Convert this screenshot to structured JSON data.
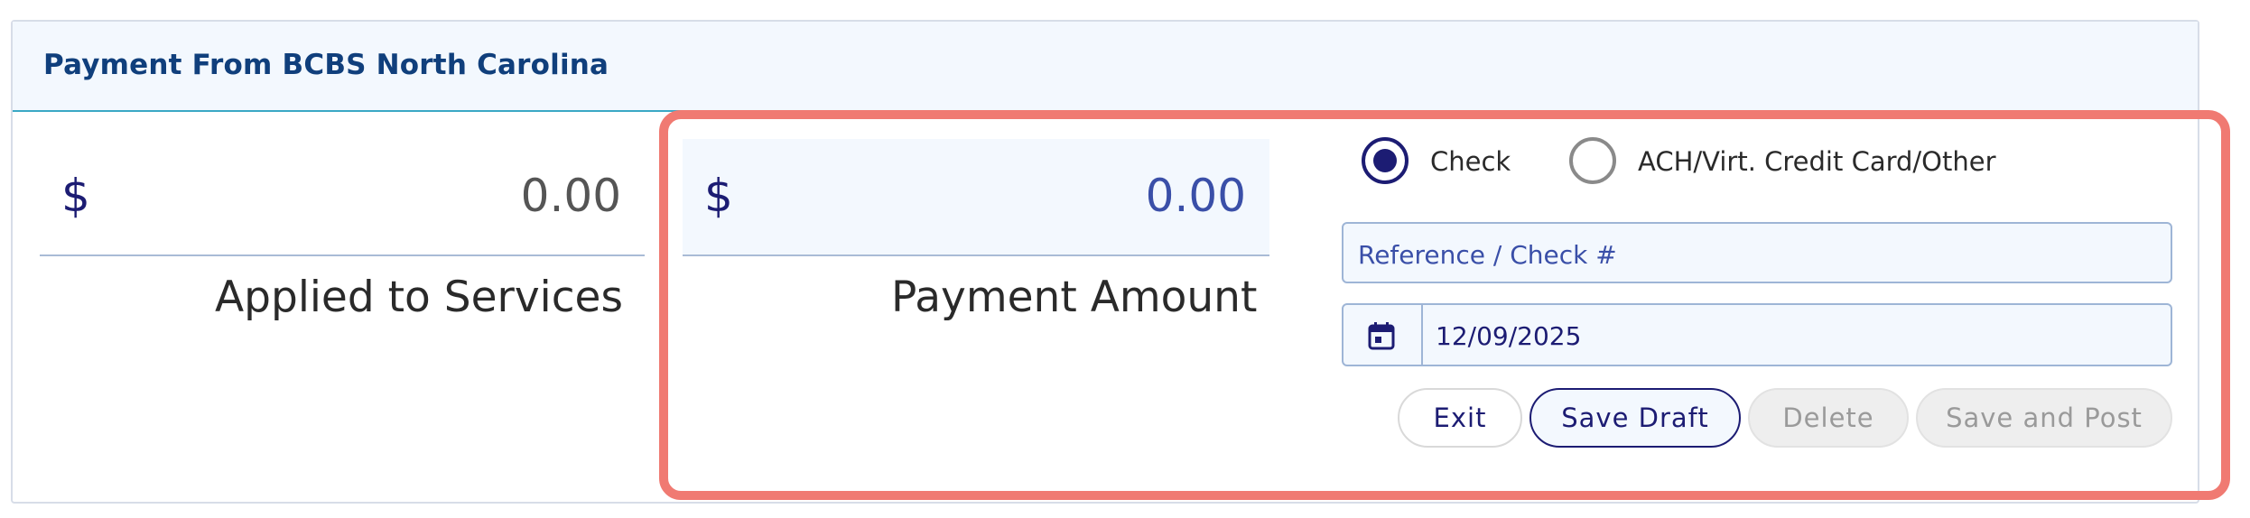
{
  "header": {
    "title": "Payment From BCBS North Carolina"
  },
  "applied": {
    "currency": "$",
    "value": "0.00",
    "label": "Applied to Services"
  },
  "payment": {
    "currency": "$",
    "value": "0.00",
    "label": "Payment Amount"
  },
  "method": {
    "options": [
      {
        "label": "Check",
        "selected": true
      },
      {
        "label": "ACH/Virt. Credit Card/Other",
        "selected": false
      }
    ]
  },
  "reference": {
    "placeholder": "Reference / Check #",
    "value": ""
  },
  "date": {
    "value": "12/09/2025",
    "icon": "calendar-icon"
  },
  "buttons": {
    "exit": "Exit",
    "save_draft": "Save Draft",
    "delete": "Delete",
    "save_post": "Save and Post"
  },
  "colors": {
    "primary": "#1c1c73",
    "header_title": "#103f7c",
    "highlight": "#f07a72",
    "panel_bg": "#f3f8fe"
  }
}
